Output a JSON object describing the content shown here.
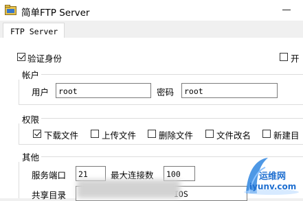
{
  "window": {
    "title": "简单FTP Server"
  },
  "tabs": [
    {
      "label": "FTP Server"
    }
  ],
  "auth": {
    "verify_label": "验证身份",
    "verify_checked": true,
    "second_label": "开"
  },
  "account": {
    "heading": "帐户",
    "user_label": "用户",
    "user_value": "root",
    "password_label": "密码",
    "password_value": "root"
  },
  "permissions": {
    "heading": "权限",
    "items": [
      {
        "label": "下载文件",
        "checked": true
      },
      {
        "label": "上传文件",
        "checked": false
      },
      {
        "label": "删除文件",
        "checked": false
      },
      {
        "label": "文件改名",
        "checked": false
      },
      {
        "label": "新建目",
        "checked": false
      }
    ]
  },
  "other": {
    "heading": "其他",
    "port_label": "服务端口",
    "port_value": "21",
    "max_conn_label": "最大连接数",
    "max_conn_value": "100",
    "shared_dir_label": "共享目录",
    "shared_dir_value": "IOS"
  },
  "watermark": {
    "line1": "运维网",
    "line2": "iyunv.com"
  }
}
